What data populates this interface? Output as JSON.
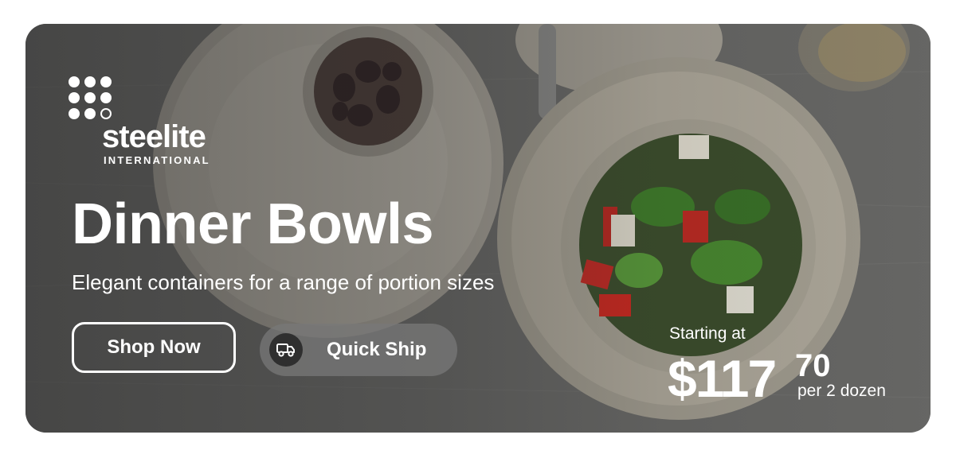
{
  "brand": {
    "name": "steelite",
    "tagline": "INTERNATIONAL"
  },
  "hero": {
    "title": "Dinner Bowls",
    "subtitle": "Elegant containers for a range of portion sizes"
  },
  "actions": {
    "shop_now": "Shop Now",
    "quick_ship": "Quick Ship",
    "quick_ship_icon": "truck-icon"
  },
  "pricing": {
    "starting_label": "Starting at",
    "amount": "$117",
    "cents": "70",
    "unit": "per 2 dozen"
  },
  "colors": {
    "text": "#ffffff",
    "icon_badge": "#2f2f2f"
  }
}
